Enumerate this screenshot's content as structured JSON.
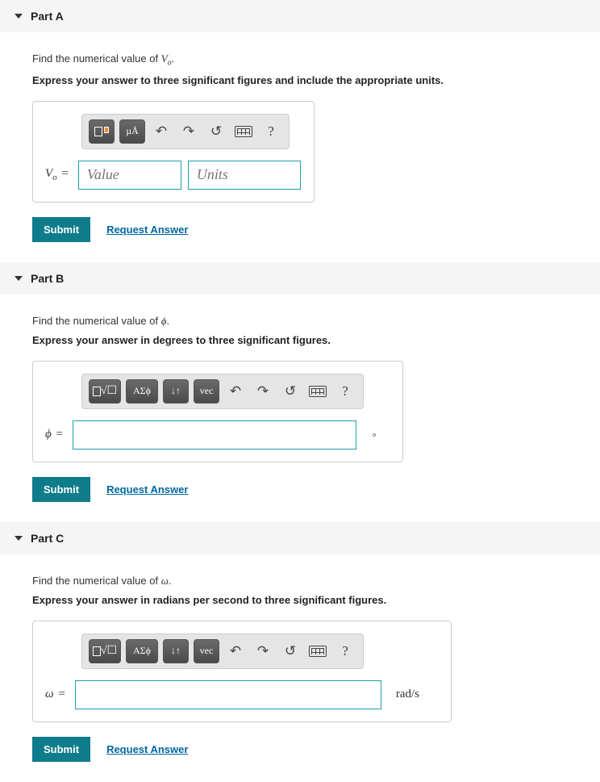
{
  "common": {
    "submit": "Submit",
    "request": "Request Answer",
    "help": "?"
  },
  "partA": {
    "title": "Part A",
    "prompt_pre": "Find the numerical value of ",
    "prompt_var": "V",
    "prompt_sub": "o",
    "prompt_post": ".",
    "instruction": "Express your answer to three significant figures and include the appropriate units.",
    "lhs_var": "V",
    "lhs_sub": "o",
    "equals": " = ",
    "value_placeholder": "Value",
    "units_placeholder": "Units",
    "tool_units": "µÅ"
  },
  "partB": {
    "title": "Part B",
    "prompt_pre": "Find the numerical value of ",
    "prompt_var": "ϕ",
    "prompt_post": ".",
    "instruction": "Express your answer in degrees to three significant figures.",
    "lhs_var": "ϕ",
    "equals": " = ",
    "unit_suffix": "∘",
    "tool_greek": "ΑΣϕ",
    "tool_vec": "vec",
    "tool_updown": "↓↑"
  },
  "partC": {
    "title": "Part C",
    "prompt_pre": "Find the numerical value of ",
    "prompt_var": "ω",
    "prompt_post": ".",
    "instruction": "Express your answer in radians per second to three significant figures.",
    "lhs_var": "ω",
    "equals": " = ",
    "unit_suffix": "rad/s",
    "tool_greek": "ΑΣϕ",
    "tool_vec": "vec",
    "tool_updown": "↓↑"
  }
}
